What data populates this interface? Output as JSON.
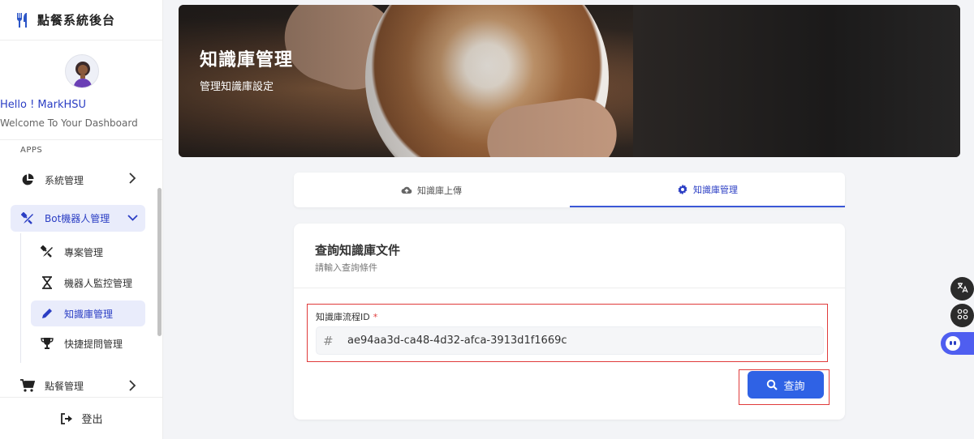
{
  "sidebar": {
    "brand": "點餐系統後台",
    "hello": "Hello ! MarkHSU",
    "welcome": "Welcome To Your Dashboard",
    "section": "APPS",
    "items": {
      "system": "系統管理",
      "bot": "Bot機器人管理",
      "project": "專案管理",
      "monitor": "機器人監控管理",
      "knowledge": "知識庫管理",
      "quick": "快捷提問管理",
      "order": "點餐管理"
    },
    "logout": "登出"
  },
  "hero": {
    "title": "知識庫管理",
    "subtitle": "管理知識庫設定"
  },
  "tabs": {
    "upload": "知識庫上傳",
    "manage": "知識庫管理"
  },
  "query": {
    "title": "查詢知識庫文件",
    "subtitle": "請輸入查詢條件",
    "field_label": "知識庫流程ID",
    "required_mark": "*",
    "field_prefix": "#",
    "field_value": "ae94aa3d-ca48-4d32-afca-3913d1f1669c",
    "button": "查詢"
  },
  "colors": {
    "accent": "#2b3ec4",
    "primary_button": "#2f62e5",
    "highlight_border": "#e03b3b",
    "active_bg": "#e9ecfb"
  }
}
